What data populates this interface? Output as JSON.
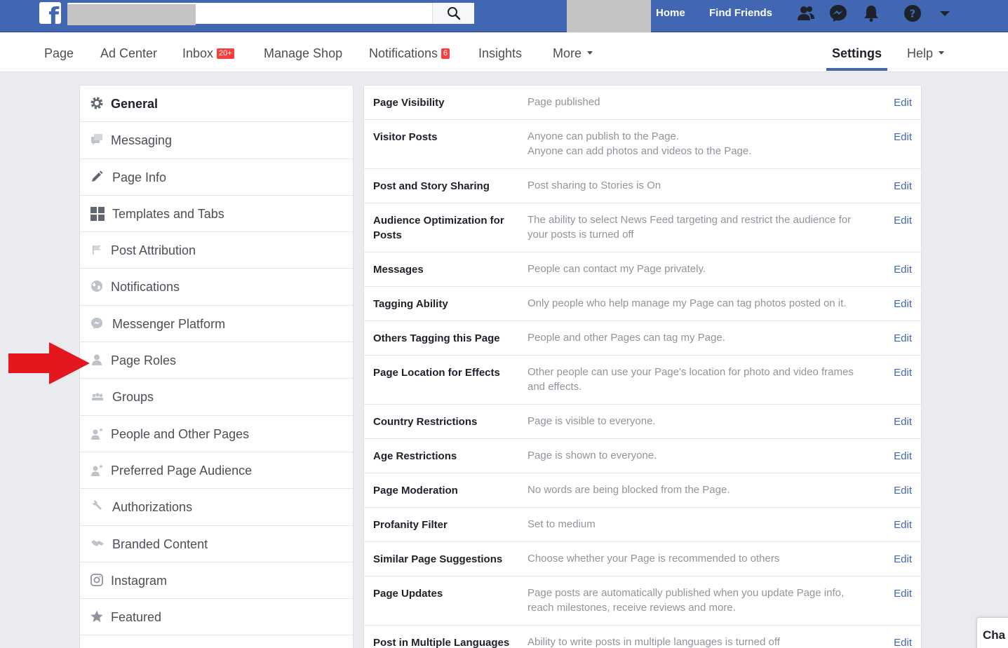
{
  "topbar": {
    "logo_letter": "f",
    "home": "Home",
    "find_friends": "Find Friends"
  },
  "pagenav": {
    "page": "Page",
    "ad_center": "Ad Center",
    "inbox": "Inbox",
    "inbox_badge": "20+",
    "manage_shop": "Manage Shop",
    "notifications": "Notifications",
    "notifications_badge": "6",
    "insights": "Insights",
    "more": "More",
    "settings": "Settings",
    "help": "Help"
  },
  "sidebar": {
    "items": [
      {
        "label": "General",
        "icon": "gear-icon",
        "active": true
      },
      {
        "label": "Messaging",
        "icon": "messaging-icon"
      },
      {
        "label": "Page Info",
        "icon": "pencil-icon"
      },
      {
        "label": "Templates and Tabs",
        "icon": "grid-icon"
      },
      {
        "label": "Post Attribution",
        "icon": "flag-icon"
      },
      {
        "label": "Notifications",
        "icon": "globe-icon"
      },
      {
        "label": "Messenger Platform",
        "icon": "messenger-icon"
      },
      {
        "label": "Page Roles",
        "icon": "person-icon"
      },
      {
        "label": "Groups",
        "icon": "group-icon"
      },
      {
        "label": "People and Other Pages",
        "icon": "person-star-icon"
      },
      {
        "label": "Preferred Page Audience",
        "icon": "person-star-icon"
      },
      {
        "label": "Authorizations",
        "icon": "wrench-icon"
      },
      {
        "label": "Branded Content",
        "icon": "handshake-icon"
      },
      {
        "label": "Instagram",
        "icon": "instagram-icon"
      },
      {
        "label": "Featured",
        "icon": "star-icon"
      }
    ]
  },
  "settings": {
    "edit_label": "Edit",
    "rows": [
      {
        "title": "Page Visibility",
        "value": [
          "Page published"
        ]
      },
      {
        "title": "Visitor Posts",
        "value": [
          "Anyone can publish to the Page.",
          "Anyone can add photos and videos to the Page."
        ]
      },
      {
        "title": "Post and Story Sharing",
        "value": [
          "Post sharing to Stories is On"
        ]
      },
      {
        "title": "Audience Optimization for Posts",
        "value": [
          "The ability to select News Feed targeting and restrict the audience for your posts is turned off"
        ]
      },
      {
        "title": "Messages",
        "value": [
          "People can contact my Page privately."
        ]
      },
      {
        "title": "Tagging Ability",
        "value": [
          "Only people who help manage my Page can tag photos posted on it."
        ]
      },
      {
        "title": "Others Tagging this Page",
        "value": [
          "People and other Pages can tag my Page."
        ]
      },
      {
        "title": "Page Location for Effects",
        "value": [
          "Other people can use your Page's location for photo and video frames and effects."
        ]
      },
      {
        "title": "Country Restrictions",
        "value": [
          "Page is visible to everyone."
        ]
      },
      {
        "title": "Age Restrictions",
        "value": [
          "Page is shown to everyone."
        ]
      },
      {
        "title": "Page Moderation",
        "value": [
          "No words are being blocked from the Page."
        ]
      },
      {
        "title": "Profanity Filter",
        "value": [
          "Set to medium"
        ]
      },
      {
        "title": "Similar Page Suggestions",
        "value": [
          "Choose whether your Page is recommended to others"
        ]
      },
      {
        "title": "Page Updates",
        "value": [
          "Page posts are automatically published when you update Page info, reach milestones, receive reviews and more."
        ]
      },
      {
        "title": "Post in Multiple Languages",
        "value": [
          "Ability to write posts in multiple languages is turned off"
        ]
      }
    ]
  },
  "chat": {
    "label": "Cha"
  },
  "colors": {
    "brand": "#4267b2",
    "badge": "#fa3e3e",
    "arrow": "#e3171e"
  }
}
